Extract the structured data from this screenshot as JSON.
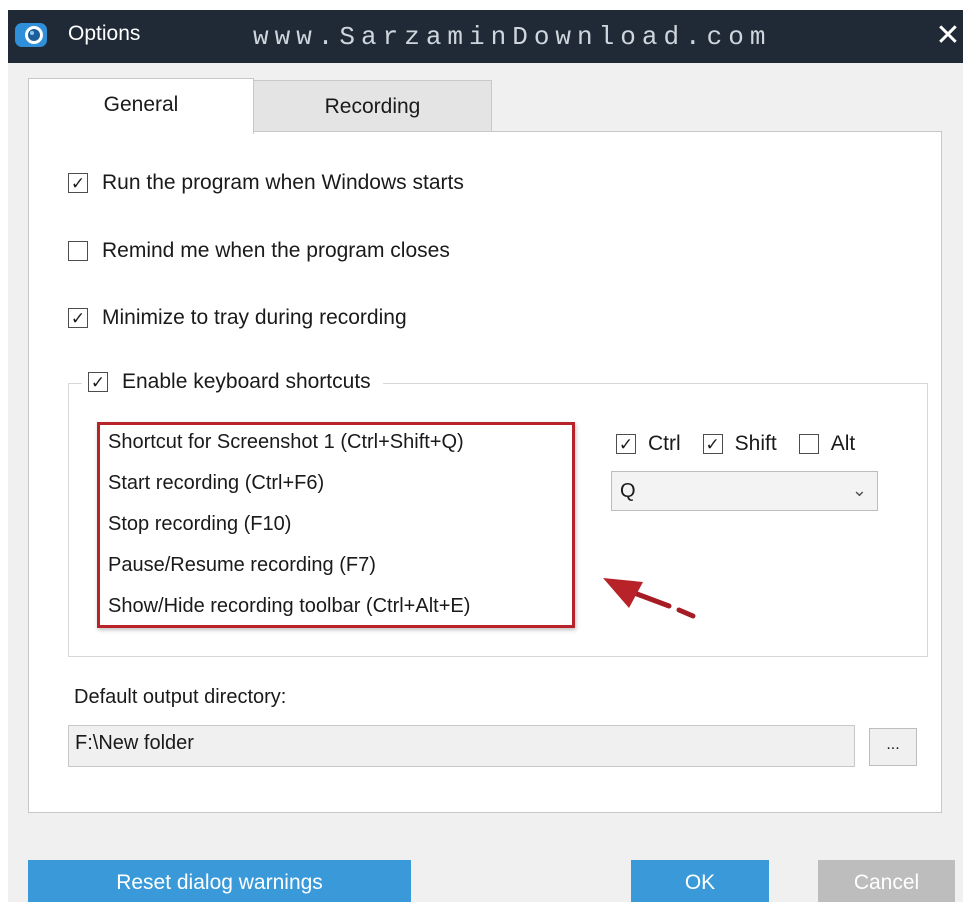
{
  "window": {
    "title": "Options",
    "watermark": "www.SarzaminDownload.com",
    "close_label": "✕",
    "icon": "webcam-icon"
  },
  "tabs": [
    {
      "label": "General",
      "active": true
    },
    {
      "label": "Recording",
      "active": false
    }
  ],
  "general": {
    "options": [
      {
        "label": "Run the program when Windows starts",
        "checked": true
      },
      {
        "label": "Remind me when the program closes",
        "checked": false
      },
      {
        "label": "Minimize to tray during recording",
        "checked": true
      }
    ],
    "shortcuts_group": {
      "label": "Enable keyboard shortcuts",
      "checked": true,
      "items": [
        "Shortcut for Screenshot 1 (Ctrl+Shift+Q)",
        "Start recording (Ctrl+F6)",
        "Stop recording (F10)",
        "Pause/Resume recording (F7)",
        "Show/Hide recording toolbar (Ctrl+Alt+E)"
      ],
      "modifiers": [
        {
          "label": "Ctrl",
          "checked": true
        },
        {
          "label": "Shift",
          "checked": true
        },
        {
          "label": "Alt",
          "checked": false
        }
      ],
      "key": "Q"
    },
    "output": {
      "label": "Default output directory:",
      "value": "F:\\New folder",
      "browse_label": "..."
    }
  },
  "buttons": {
    "reset": "Reset dialog warnings",
    "ok": "OK",
    "cancel": "Cancel"
  },
  "colors": {
    "accent": "#3a9ad9",
    "highlight_box": "#b8232a",
    "disabled": "#bdbdbd",
    "titlebar": "#1f2a36"
  }
}
